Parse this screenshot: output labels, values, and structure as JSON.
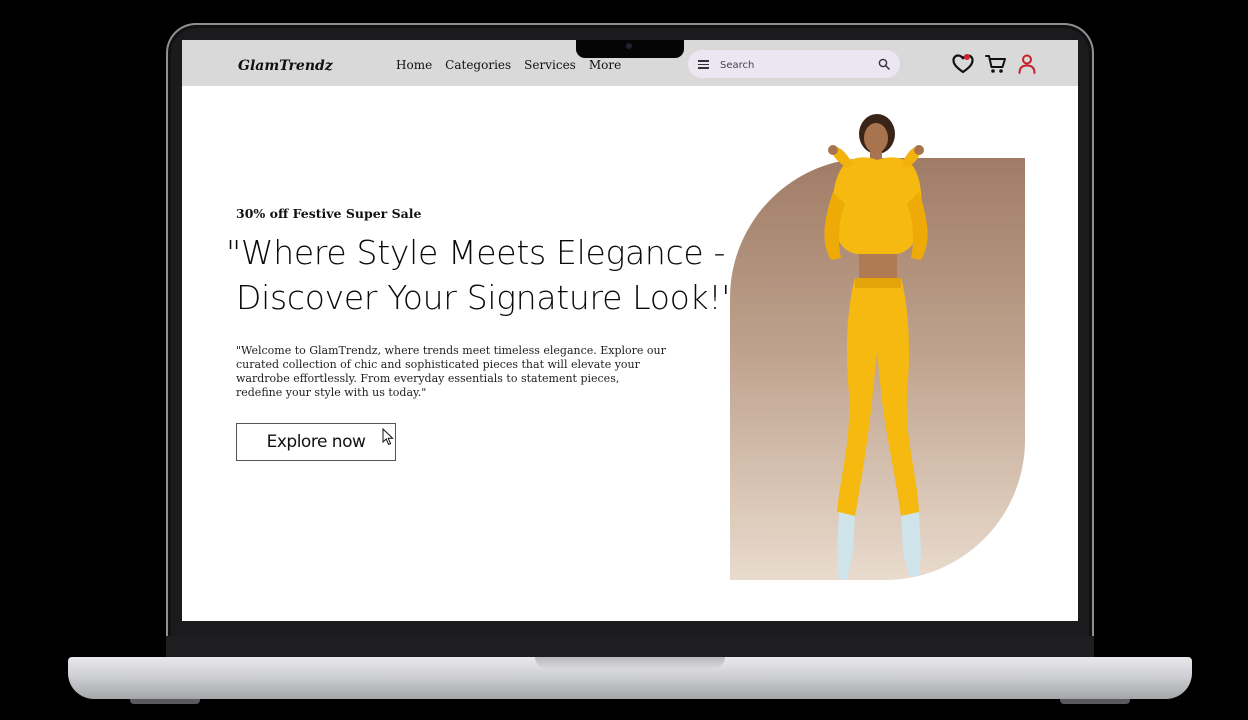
{
  "nav": {
    "logo": "GlamTrendz",
    "links": [
      "Home",
      "Categories",
      "Services",
      "More"
    ],
    "search_placeholder": "Search"
  },
  "hero": {
    "sale_tag": "30% off Festive Super Sale",
    "headline_line1": "\"Where Style Meets Elegance -",
    "headline_line2": "Discover Your Signature Look!\"",
    "description": "\"Welcome to GlamTrendz, where trends meet timeless elegance. Explore our curated collection of chic and sophisticated pieces that will elevate your wardrobe effortlessly. From everyday essentials to statement pieces, redefine your style with us today.\"",
    "cta_label": "Explore now"
  },
  "icons": {
    "wishlist": "heart-icon",
    "cart": "cart-icon",
    "account": "user-icon",
    "search": "search-icon",
    "menu": "menu-icon"
  },
  "colors": {
    "navbar_bg": "#d9d9d9",
    "search_bg": "#ece6f2",
    "accent_red": "#d3202a",
    "outfit_yellow": "#f5b90f",
    "backdrop_top": "#a07c66",
    "backdrop_bottom": "#e9dbcd"
  }
}
